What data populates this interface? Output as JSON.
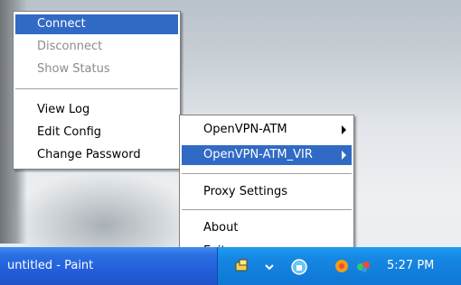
{
  "menu_main": {
    "items": [
      {
        "label": "Connect",
        "state": "highlighted"
      },
      {
        "label": "Disconnect",
        "state": "disabled"
      },
      {
        "label": "Show Status",
        "state": "disabled"
      },
      {
        "label": "View Log",
        "state": "normal"
      },
      {
        "label": "Edit Config",
        "state": "normal"
      },
      {
        "label": "Change Password",
        "state": "normal"
      }
    ]
  },
  "menu_tray": {
    "items": [
      {
        "label": "OpenVPN-ATM",
        "has_submenu": true
      },
      {
        "label": "OpenVPN-ATM_VIR",
        "has_submenu": true,
        "state": "highlighted"
      },
      {
        "label": "Proxy Settings"
      },
      {
        "label": "About"
      },
      {
        "label": "Exit"
      }
    ]
  },
  "taskbar": {
    "task_label": "untitled - Paint",
    "clock": "5:27 PM"
  },
  "colors": {
    "highlight": "#316ac5",
    "taskbar": "#245edb",
    "tray": "#0f76d4"
  }
}
